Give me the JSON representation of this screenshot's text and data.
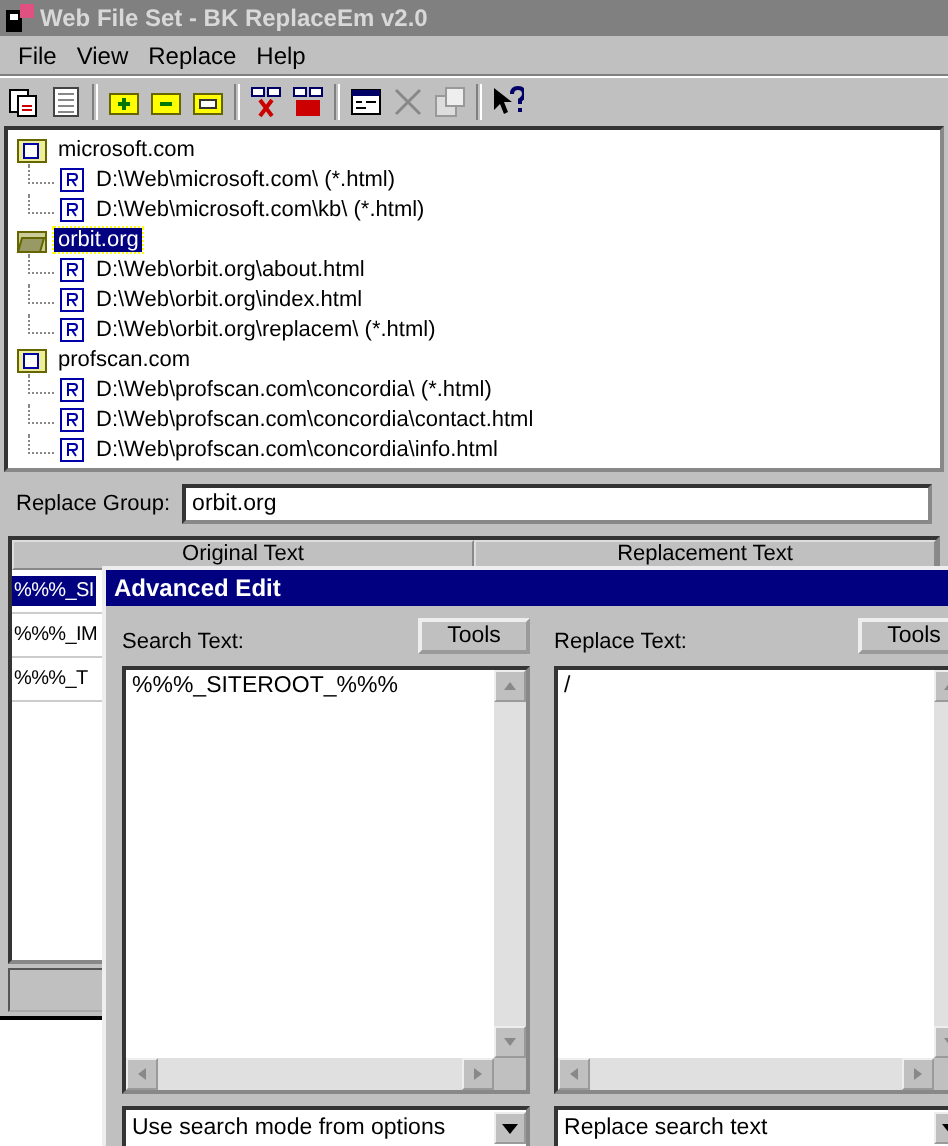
{
  "window": {
    "title": "Web File Set - BK ReplaceEm v2.0"
  },
  "menu": [
    "File",
    "View",
    "Replace",
    "Help"
  ],
  "tree": [
    {
      "label": "microsoft.com",
      "selected": false,
      "children": [
        {
          "label": "D:\\Web\\microsoft.com\\ (*.html)"
        },
        {
          "label": "D:\\Web\\microsoft.com\\kb\\ (*.html)"
        }
      ]
    },
    {
      "label": "orbit.org",
      "selected": true,
      "children": [
        {
          "label": "D:\\Web\\orbit.org\\about.html"
        },
        {
          "label": "D:\\Web\\orbit.org\\index.html"
        },
        {
          "label": "D:\\Web\\orbit.org\\replacem\\ (*.html)"
        }
      ]
    },
    {
      "label": "profscan.com",
      "selected": false,
      "children": [
        {
          "label": "D:\\Web\\profscan.com\\concordia\\ (*.html)"
        },
        {
          "label": "D:\\Web\\profscan.com\\concordia\\contact.html"
        },
        {
          "label": "D:\\Web\\profscan.com\\concordia\\info.html"
        }
      ]
    }
  ],
  "replace_group": {
    "label": "Replace Group:",
    "value": "orbit.org"
  },
  "table": {
    "columns": [
      "Original Text",
      "Replacement Text"
    ],
    "rows": [
      {
        "cell": "%%%_SI",
        "selected": true
      },
      {
        "cell": "%%%_IM",
        "selected": false
      },
      {
        "cell": "%%%_T",
        "selected": false
      }
    ]
  },
  "dialog": {
    "title": "Advanced Edit",
    "panes": [
      {
        "label": "Search Text:",
        "tools": "Tools",
        "value": "%%%_SITEROOT_%%%",
        "mode": "Use search mode from options"
      },
      {
        "label": "Replace Text:",
        "tools": "Tools",
        "value": "/",
        "mode": "Replace search text"
      }
    ]
  }
}
